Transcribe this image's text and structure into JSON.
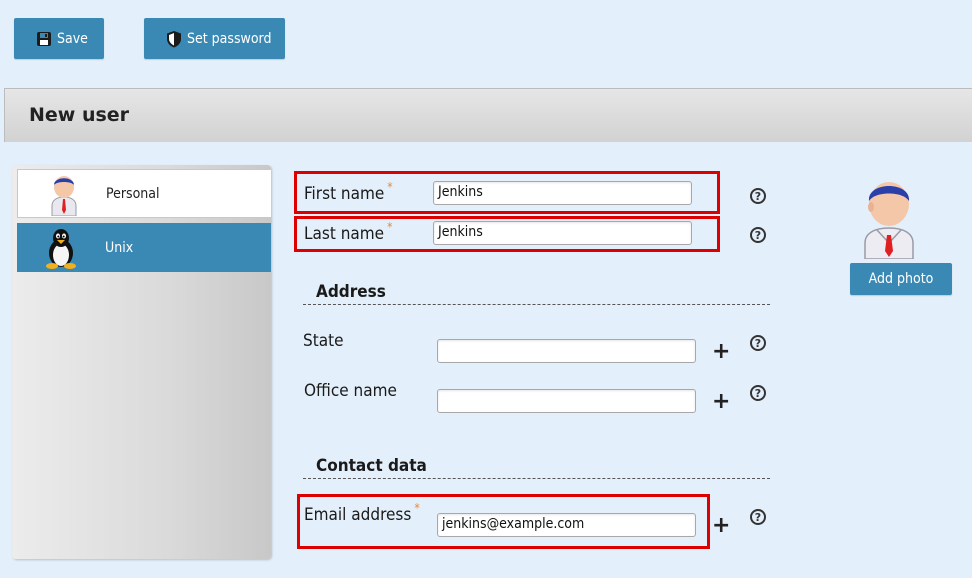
{
  "toolbar": {
    "save_label": "Save",
    "set_password_label": "Set password"
  },
  "panel": {
    "title": "New user"
  },
  "sidebar": {
    "items": [
      {
        "label": "Personal",
        "icon": "user-icon",
        "active": false
      },
      {
        "label": "Unix",
        "icon": "penguin-icon",
        "active": true
      }
    ]
  },
  "form": {
    "first_name": {
      "label": "First name",
      "required": "*",
      "value": "Jenkins"
    },
    "last_name": {
      "label": "Last name",
      "required": "*",
      "value": "Jenkins"
    },
    "address": {
      "title": "Address",
      "state": {
        "label": "State",
        "value": ""
      },
      "office_name": {
        "label": "Office name",
        "value": ""
      }
    },
    "contact": {
      "title": "Contact data",
      "email": {
        "label": "Email address",
        "required": "*",
        "value": "jenkins@example.com"
      }
    },
    "help_glyph": "?",
    "add_glyph": "+"
  },
  "photo": {
    "add_label": "Add photo"
  },
  "colors": {
    "accent": "#3a89b5",
    "background": "#e3effa",
    "highlight": "#dd0000",
    "required": "#e6893a"
  }
}
